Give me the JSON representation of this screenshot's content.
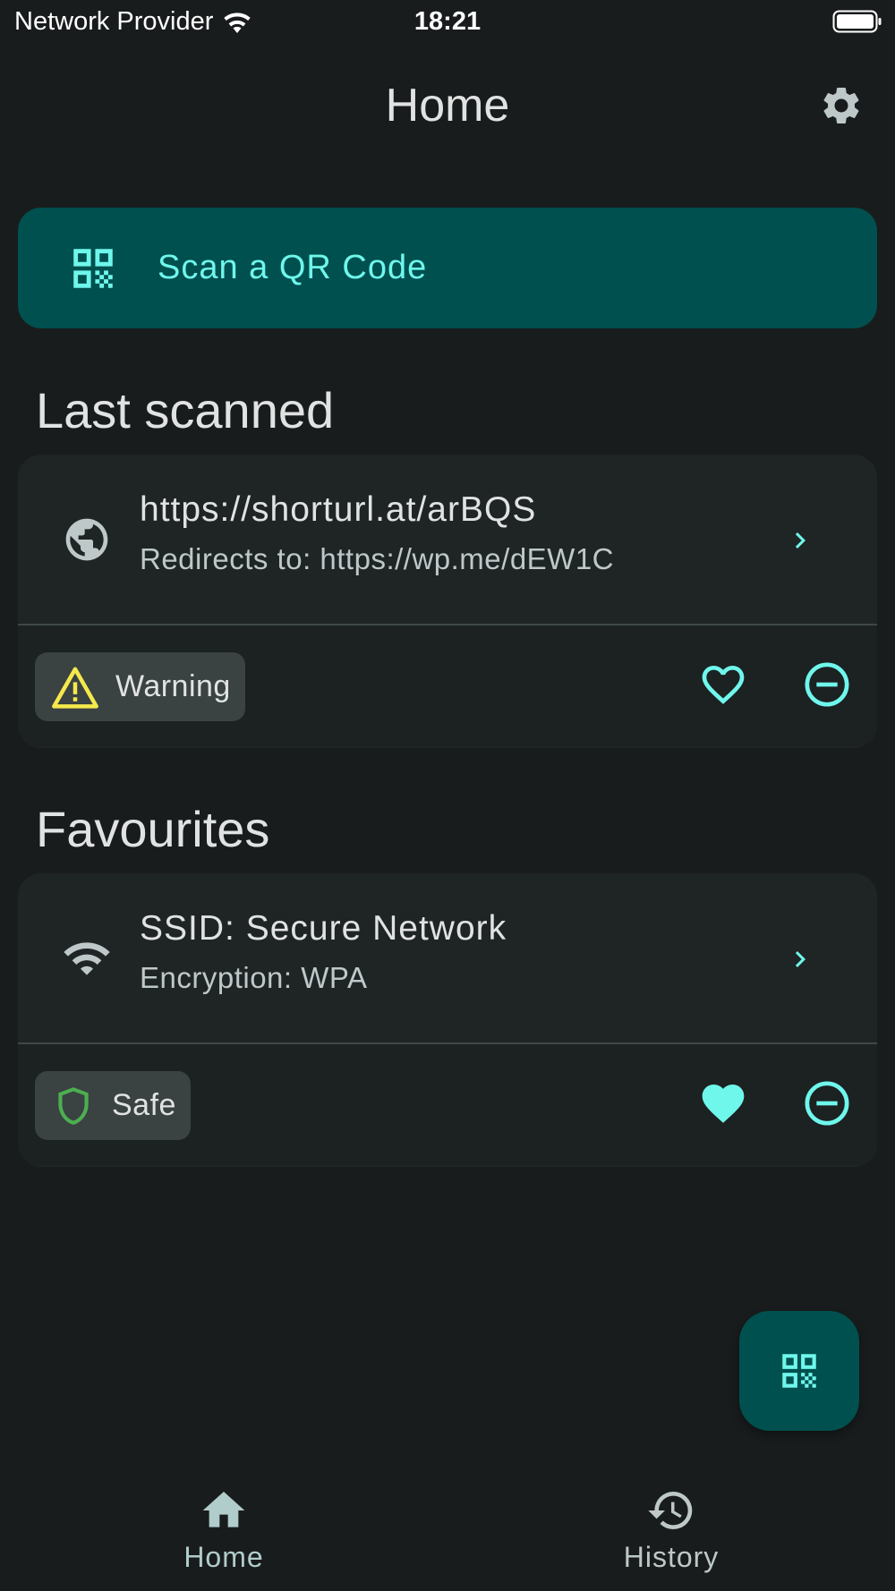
{
  "status_bar": {
    "carrier": "Network Provider",
    "time": "18:21"
  },
  "app_bar": {
    "title": "Home",
    "settings_icon": "gear-icon"
  },
  "scan_button": {
    "label": "Scan a QR Code",
    "icon": "qr-code-icon"
  },
  "last_scanned": {
    "title": "Last scanned",
    "item": {
      "icon": "globe-icon",
      "title": "https://shorturl.at/arBQS",
      "subtitle": "Redirects to: https://wp.me/dEW1C",
      "badge_label": "Warning",
      "badge_icon": "warning-triangle-icon",
      "favourite": false
    }
  },
  "favourites": {
    "title": "Favourites",
    "item": {
      "icon": "wifi-icon",
      "title": "SSID: Secure Network",
      "subtitle": "Encryption: WPA",
      "badge_label": "Safe",
      "badge_icon": "shield-icon",
      "favourite": true
    }
  },
  "bottom_nav": {
    "items": [
      {
        "label": "Home",
        "icon": "home-icon",
        "active": true
      },
      {
        "label": "History",
        "icon": "history-icon",
        "active": false
      }
    ]
  },
  "colors": {
    "background": "#191c1d",
    "accent": "#6ff7ec",
    "primary_container": "#00504f",
    "warning": "#f5e94b",
    "safe": "#4caf50"
  }
}
